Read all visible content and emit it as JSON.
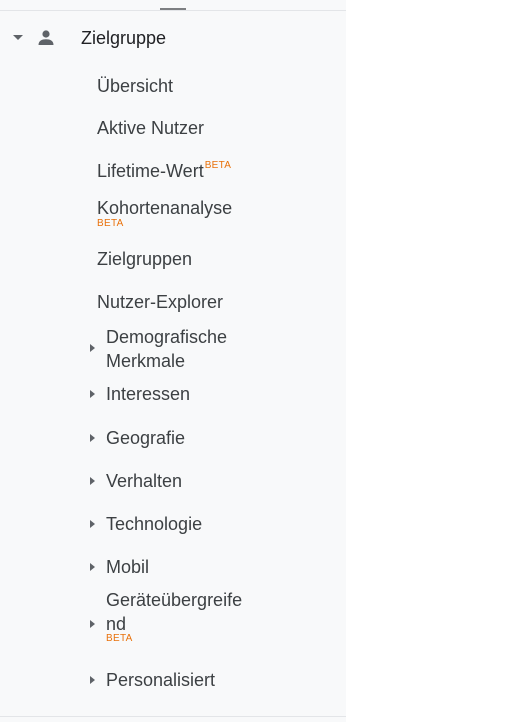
{
  "section": {
    "title": "Zielgruppe",
    "icon": "person-icon"
  },
  "beta_label": "BETA",
  "beta_color": "#e8710a",
  "items": {
    "overview": "Übersicht",
    "active_users": "Aktive Nutzer",
    "lifetime_value": "Lifetime-Wert",
    "cohort": "Kohortenanalyse",
    "audiences": "Zielgruppen",
    "user_explorer": "Nutzer-Explorer"
  },
  "groups": {
    "demographics_line1": "Demografische",
    "demographics_line2": "Merkmale",
    "interests": "Interessen",
    "geo": "Geografie",
    "behavior": "Verhalten",
    "technology": "Technologie",
    "mobile": "Mobil",
    "cross_device_line1": "Geräteübergreife",
    "cross_device_line2": "nd",
    "personalized": "Personalisiert"
  }
}
